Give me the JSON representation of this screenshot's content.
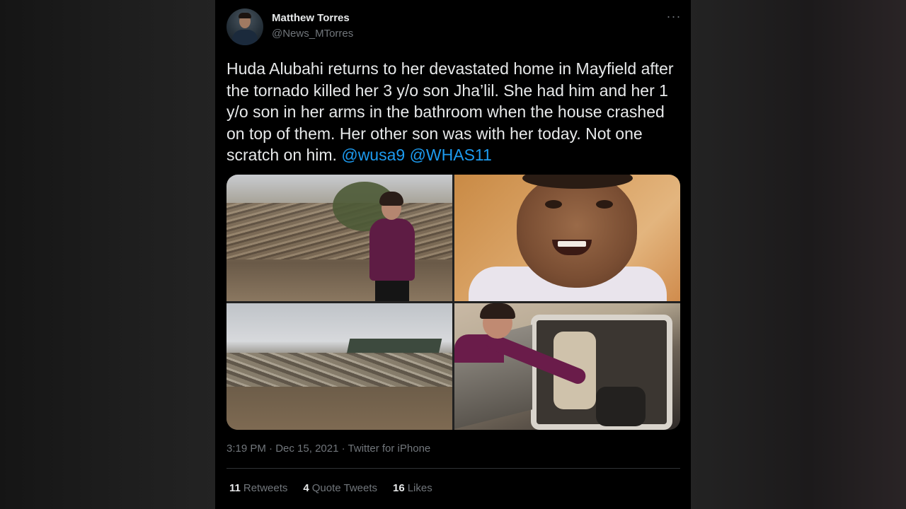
{
  "colors": {
    "background": "#000000",
    "text": "#e7e9ea",
    "secondary": "#71767b",
    "mention": "#1d9bf0",
    "divider": "#2f3336"
  },
  "author": {
    "name": "Matthew Torres",
    "handle": "@News_MTorres",
    "avatar_icon": "user-avatar-photo"
  },
  "menu": {
    "more_icon": "more-horizontal-icon",
    "label": "···"
  },
  "tweet": {
    "text": "Huda Alubahi returns to her devastated home in Mayfield after the tornado killed her 3 y/o son Jha’lil. She had him and her 1 y/o son in her arms in the bathroom when the house crashed on top of them. Her other son was with her today. Not one scratch on him.",
    "mentions": [
      "@wusa9",
      "@WHAS11"
    ]
  },
  "media": {
    "photos": [
      {
        "icon": "photo-woman-tornado-debris"
      },
      {
        "icon": "photo-smiling-child"
      },
      {
        "icon": "photo-destroyed-houses"
      },
      {
        "icon": "photo-mother-car-seat"
      }
    ]
  },
  "meta": {
    "time": "3:19 PM",
    "date": "Dec 15, 2021",
    "source": "Twitter for iPhone",
    "separator": "·"
  },
  "stats": {
    "retweets": {
      "count": "11",
      "label": "Retweets"
    },
    "quotes": {
      "count": "4",
      "label": "Quote Tweets"
    },
    "likes": {
      "count": "16",
      "label": "Likes"
    }
  }
}
